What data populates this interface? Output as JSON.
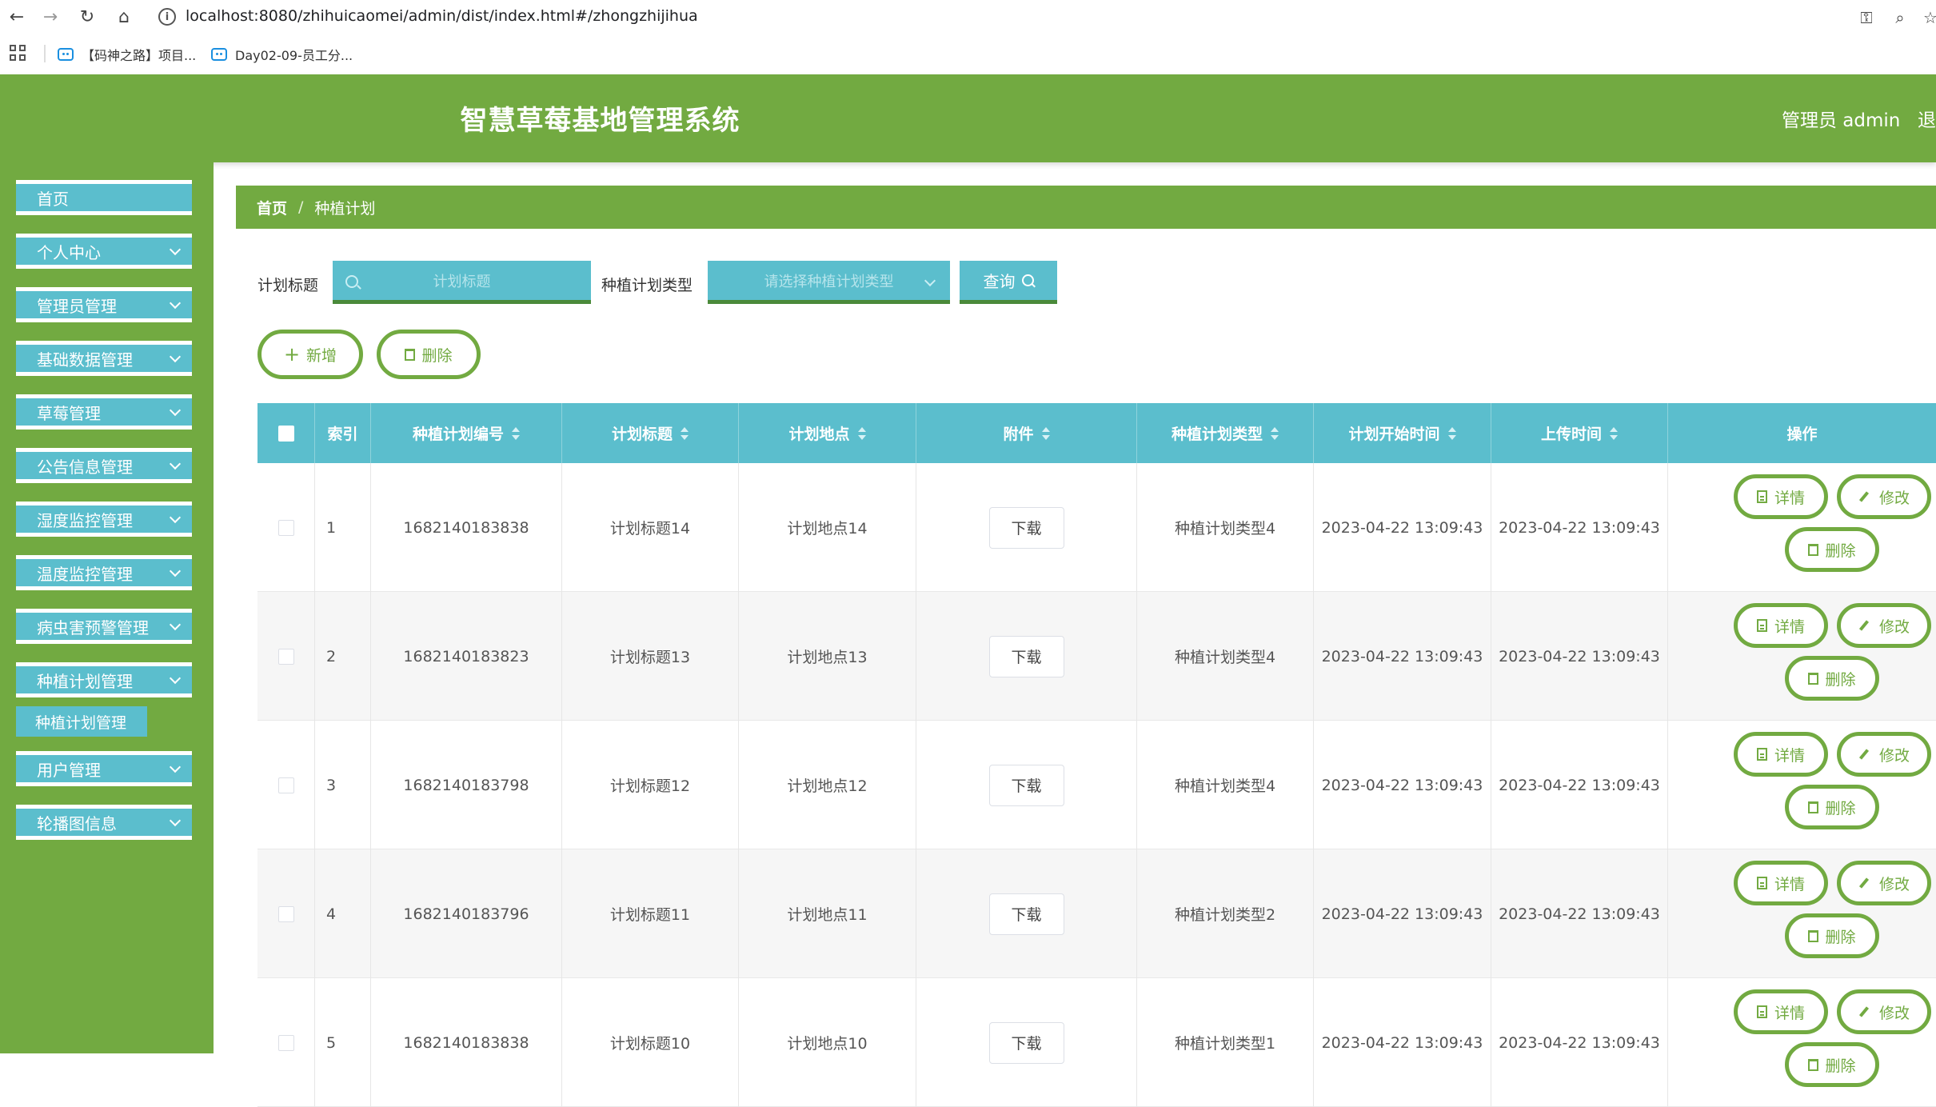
{
  "browser": {
    "url": "localhost:8080/zhihuicaomei/admin/dist/index.html#/zhongzhijihua",
    "bookmarks": [
      "【码神之路】项目...",
      "Day02-09-员工分..."
    ]
  },
  "header": {
    "title": "智慧草莓基地管理系统",
    "user": "管理员 admin",
    "logout": "退"
  },
  "sidebar": {
    "items": [
      {
        "label": "首页"
      },
      {
        "label": "个人中心"
      },
      {
        "label": "管理员管理"
      },
      {
        "label": "基础数据管理"
      },
      {
        "label": "草莓管理"
      },
      {
        "label": "公告信息管理"
      },
      {
        "label": "湿度监控管理"
      },
      {
        "label": "温度监控管理"
      },
      {
        "label": "病虫害预警管理"
      },
      {
        "label": "种植计划管理"
      },
      {
        "label": "用户管理"
      },
      {
        "label": "轮播图信息"
      }
    ],
    "active_sub": "种植计划管理"
  },
  "breadcrumb": {
    "home": "首页",
    "separator": "/",
    "current": "种植计划"
  },
  "search": {
    "title_label": "计划标题",
    "title_placeholder": "计划标题",
    "type_label": "种植计划类型",
    "type_placeholder": "请选择种植计划类型",
    "query_button": "查询"
  },
  "actions": {
    "add": "新增",
    "delete": "删除"
  },
  "table": {
    "columns": [
      "索引",
      "种植计划编号",
      "计划标题",
      "计划地点",
      "附件",
      "种植计划类型",
      "计划开始时间",
      "上传时间",
      "操作"
    ],
    "download_label": "下载",
    "detail_label": "详情",
    "edit_label": "修改",
    "delete_label": "删除",
    "rows": [
      {
        "index": "1",
        "code": "1682140183838",
        "title": "计划标题14",
        "place": "计划地点14",
        "type": "种植计划类型4",
        "start": "2023-04-22 13:09:43",
        "upload": "2023-04-22 13:09:43"
      },
      {
        "index": "2",
        "code": "1682140183823",
        "title": "计划标题13",
        "place": "计划地点13",
        "type": "种植计划类型4",
        "start": "2023-04-22 13:09:43",
        "upload": "2023-04-22 13:09:43"
      },
      {
        "index": "3",
        "code": "1682140183798",
        "title": "计划标题12",
        "place": "计划地点12",
        "type": "种植计划类型4",
        "start": "2023-04-22 13:09:43",
        "upload": "2023-04-22 13:09:43"
      },
      {
        "index": "4",
        "code": "1682140183796",
        "title": "计划标题11",
        "place": "计划地点11",
        "type": "种植计划类型2",
        "start": "2023-04-22 13:09:43",
        "upload": "2023-04-22 13:09:43"
      },
      {
        "index": "5",
        "code": "1682140183838",
        "title": "计划标题10",
        "place": "计划地点10",
        "type": "种植计划类型1",
        "start": "2023-04-22 13:09:43",
        "upload": "2023-04-22 13:09:43"
      }
    ]
  },
  "colors": {
    "primary_green": "#72aa41",
    "accent_teal": "#5bbecd"
  }
}
